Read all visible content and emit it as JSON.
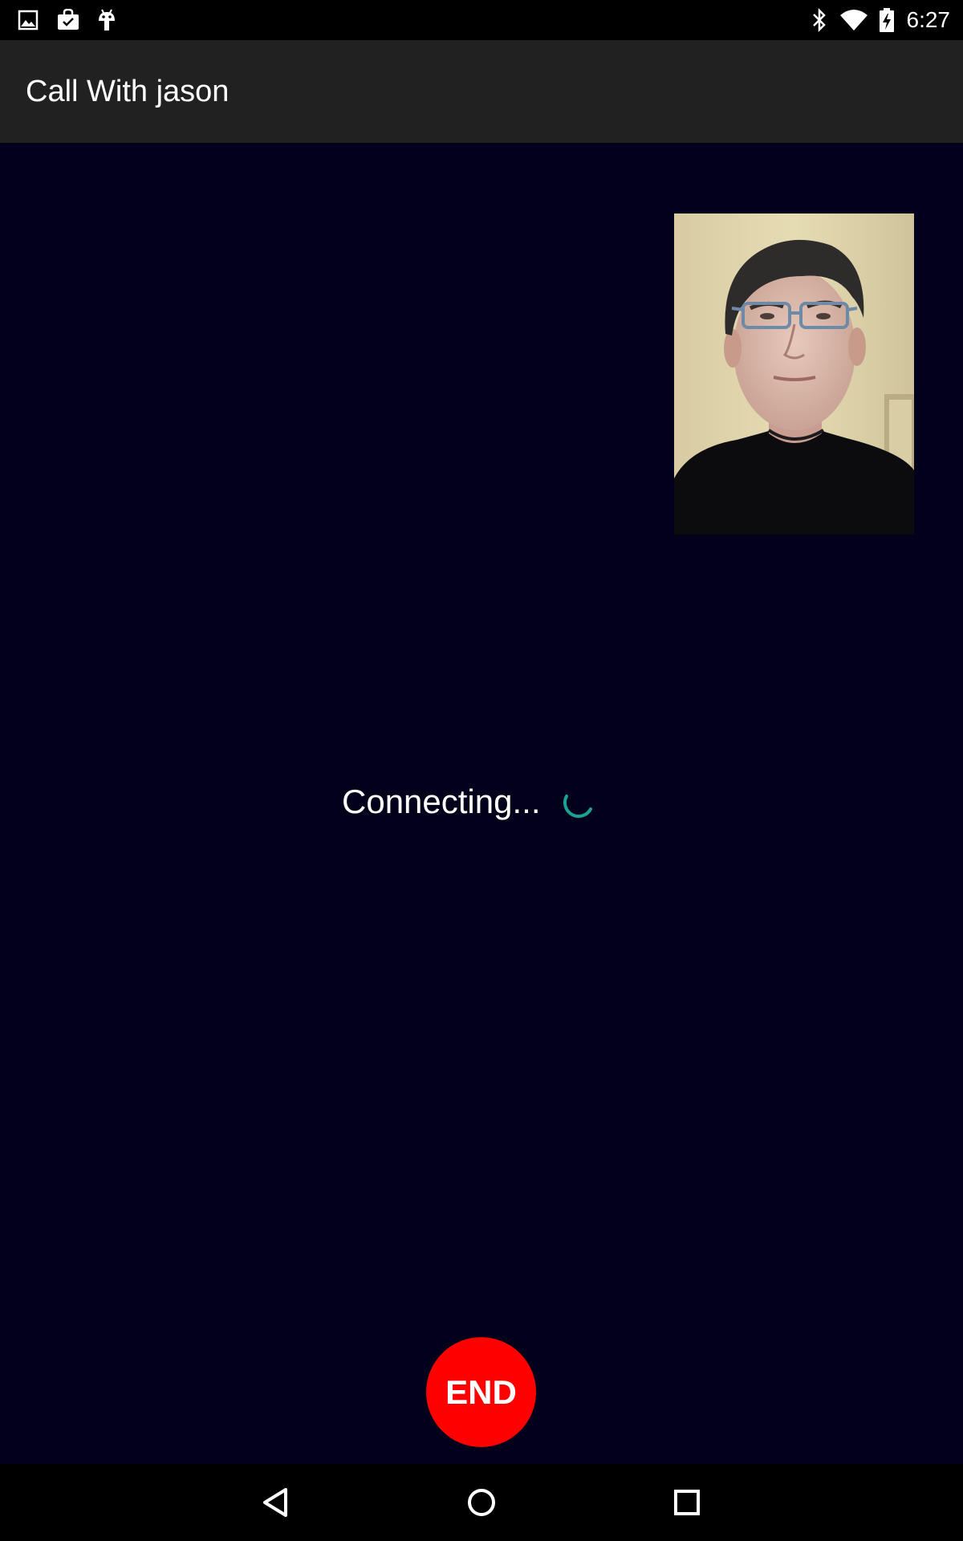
{
  "status_bar": {
    "left_icons": [
      "image-icon",
      "shopping-bag-icon",
      "android-icon"
    ],
    "right_icons": [
      "bluetooth-icon",
      "wifi-icon",
      "battery-icon"
    ],
    "time": "6:27"
  },
  "app_bar": {
    "title": "Call With jason"
  },
  "call": {
    "status_text": "Connecting...",
    "spinner_color": "#1aa394",
    "end_label": "END",
    "end_color": "#ff0000"
  },
  "nav_bar": {
    "buttons": [
      "back-icon",
      "home-icon",
      "recents-icon"
    ]
  }
}
